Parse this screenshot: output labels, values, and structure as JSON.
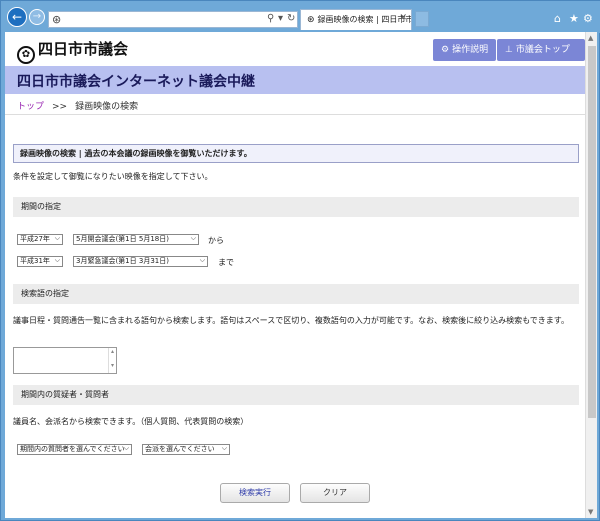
{
  "browser": {
    "tab_title": "録画映像の検索 | 四日市市...",
    "address_icons": [
      "search-icon",
      "dropdown-icon",
      "refresh-icon"
    ]
  },
  "header": {
    "logo_text": "四日市市議会",
    "help_button": "操作説明",
    "top_button": "市議会トップへ"
  },
  "banner": {
    "title": "四日市市議会インターネット議会中継"
  },
  "breadcrumb": {
    "home": "トップ",
    "separator": ">>",
    "current": "録画映像の検索"
  },
  "notice": "録画映像の検索 | 過去の本会議の録画映像を御覧いただけます。",
  "intro": "条件を設定して御覧になりたい映像を指定して下さい。",
  "period": {
    "heading": "期間の指定",
    "from_year": "平成27年",
    "from_session": "5月開会議会(第1日 5月18日)",
    "from_label": "から",
    "to_year": "平成31年",
    "to_session": "3月緊急議会(第1日 3月31日)",
    "to_label": "まで"
  },
  "keyword": {
    "heading": "検索語の指定",
    "description": "議事日程・質問通告一覧に含まれる語句から検索します。語句はスペースで区切り、複数語句の入力が可能です。なお、検索後に絞り込み検索もできます。",
    "value": ""
  },
  "questioner": {
    "heading": "期間内の質疑者・質問者",
    "description": "議員名、会派名から検索できます。（個人質問、代表質問の検索）",
    "member_select": "期間内の質問者を選んでください",
    "faction_select": "会派を選んでください"
  },
  "actions": {
    "search": "検索実行",
    "clear": "クリア"
  }
}
